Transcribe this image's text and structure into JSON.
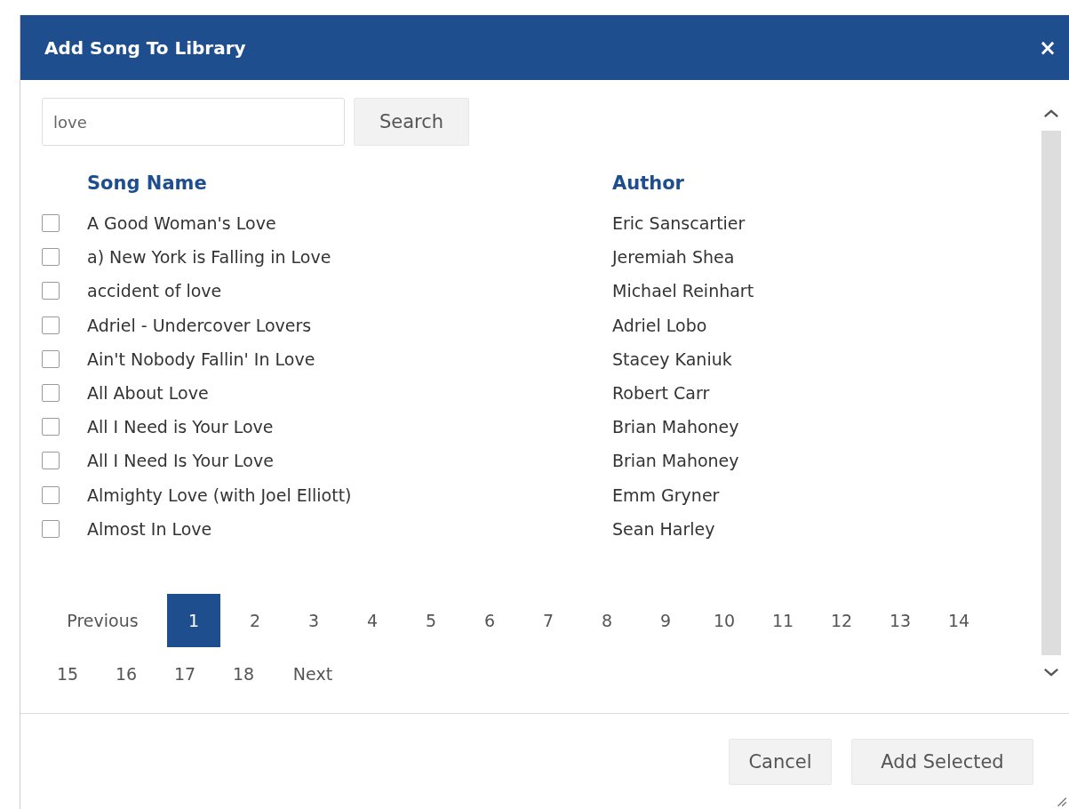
{
  "dialog": {
    "title": "Add Song To Library",
    "close": "×"
  },
  "search": {
    "value": "love",
    "button": "Search"
  },
  "table": {
    "columns": [
      "Song Name",
      "Author"
    ],
    "rows": [
      {
        "song": "A Good Woman's Love",
        "author": "Eric Sanscartier",
        "checked": false
      },
      {
        "song": "a) New York is Falling in Love",
        "author": "Jeremiah Shea",
        "checked": false
      },
      {
        "song": "accident of love",
        "author": "Michael Reinhart",
        "checked": false
      },
      {
        "song": "Adriel - Undercover Lovers",
        "author": "Adriel Lobo",
        "checked": false
      },
      {
        "song": "Ain't Nobody Fallin' In Love",
        "author": "Stacey Kaniuk",
        "checked": false
      },
      {
        "song": "All About Love",
        "author": "Robert Carr",
        "checked": false
      },
      {
        "song": "All I Need is Your Love",
        "author": "Brian Mahoney",
        "checked": false
      },
      {
        "song": "All I Need Is Your Love",
        "author": "Brian Mahoney",
        "checked": false
      },
      {
        "song": "Almighty Love (with Joel Elliott)",
        "author": "Emm Gryner",
        "checked": false
      },
      {
        "song": "Almost In Love",
        "author": "Sean Harley",
        "checked": false
      }
    ]
  },
  "pagination": {
    "previous": "Previous",
    "next": "Next",
    "pages": [
      {
        "label": "1",
        "selected": true
      },
      {
        "label": "2",
        "selected": false
      },
      {
        "label": "3",
        "selected": false
      },
      {
        "label": "4",
        "selected": false
      },
      {
        "label": "5",
        "selected": false
      },
      {
        "label": "6",
        "selected": false
      },
      {
        "label": "7",
        "selected": false
      },
      {
        "label": "8",
        "selected": false
      },
      {
        "label": "9",
        "selected": false
      },
      {
        "label": "10",
        "selected": false
      },
      {
        "label": "11",
        "selected": false
      },
      {
        "label": "12",
        "selected": false
      },
      {
        "label": "13",
        "selected": false
      },
      {
        "label": "14",
        "selected": false
      },
      {
        "label": "15",
        "selected": false
      },
      {
        "label": "16",
        "selected": false
      },
      {
        "label": "17",
        "selected": false
      },
      {
        "label": "18",
        "selected": false
      }
    ]
  },
  "buttons": [
    "Cancel",
    "Add Selected"
  ]
}
